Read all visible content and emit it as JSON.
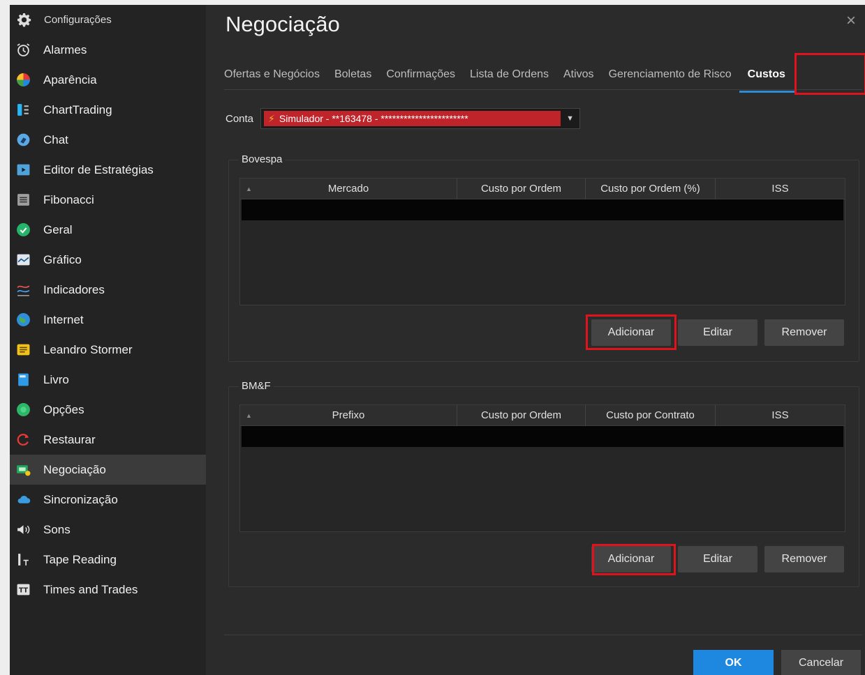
{
  "sidebar": {
    "header": {
      "label": "Configurações",
      "icon": "gear-icon"
    },
    "items": [
      {
        "label": "Alarmes",
        "icon": "alarm-clock-icon"
      },
      {
        "label": "Aparência",
        "icon": "palette-icon"
      },
      {
        "label": "ChartTrading",
        "icon": "chart-trading-icon"
      },
      {
        "label": "Chat",
        "icon": "chat-icon"
      },
      {
        "label": "Editor de Estratégias",
        "icon": "strategy-editor-icon"
      },
      {
        "label": "Fibonacci",
        "icon": "fibonacci-icon"
      },
      {
        "label": "Geral",
        "icon": "check-circle-icon"
      },
      {
        "label": "Gráfico",
        "icon": "chart-icon"
      },
      {
        "label": "Indicadores",
        "icon": "indicators-icon"
      },
      {
        "label": "Internet",
        "icon": "globe-icon"
      },
      {
        "label": "Leandro Stormer",
        "icon": "user-card-icon"
      },
      {
        "label": "Livro",
        "icon": "book-icon"
      },
      {
        "label": "Opções",
        "icon": "options-circle-icon"
      },
      {
        "label": "Restaurar",
        "icon": "restore-icon"
      },
      {
        "label": "Negociação",
        "icon": "trading-icon"
      },
      {
        "label": "Sincronização",
        "icon": "cloud-icon"
      },
      {
        "label": "Sons",
        "icon": "speaker-icon"
      },
      {
        "label": "Tape Reading",
        "icon": "tape-reading-icon"
      },
      {
        "label": "Times and Trades",
        "icon": "times-trades-icon"
      }
    ],
    "active_index": 14
  },
  "dialog": {
    "title": "Negociação",
    "close": "×"
  },
  "tabs": [
    {
      "label": "Ofertas e Negócios"
    },
    {
      "label": "Boletas"
    },
    {
      "label": "Confirmações"
    },
    {
      "label": "Lista de Ordens"
    },
    {
      "label": "Ativos"
    },
    {
      "label": "Gerenciamento de Risco"
    },
    {
      "label": "Custos"
    }
  ],
  "account": {
    "label": "Conta",
    "value": "Simulador - **163478 - ***********************"
  },
  "bovespa": {
    "title": "Bovespa",
    "columns": [
      "Mercado",
      "Custo por Ordem",
      "Custo por Ordem (%)",
      "ISS"
    ],
    "add": "Adicionar",
    "edit": "Editar",
    "remove": "Remover"
  },
  "bmf": {
    "title": "BM&F",
    "columns": [
      "Prefixo",
      "Custo por Ordem",
      "Custo por Contrato",
      "ISS"
    ],
    "add": "Adicionar",
    "edit": "Editar",
    "remove": "Remover"
  },
  "footer": {
    "ok": "OK",
    "cancel": "Cancelar"
  },
  "colors": {
    "accent": "#1e87e0",
    "highlight": "#e0121c",
    "account_bg": "#c0242b"
  }
}
